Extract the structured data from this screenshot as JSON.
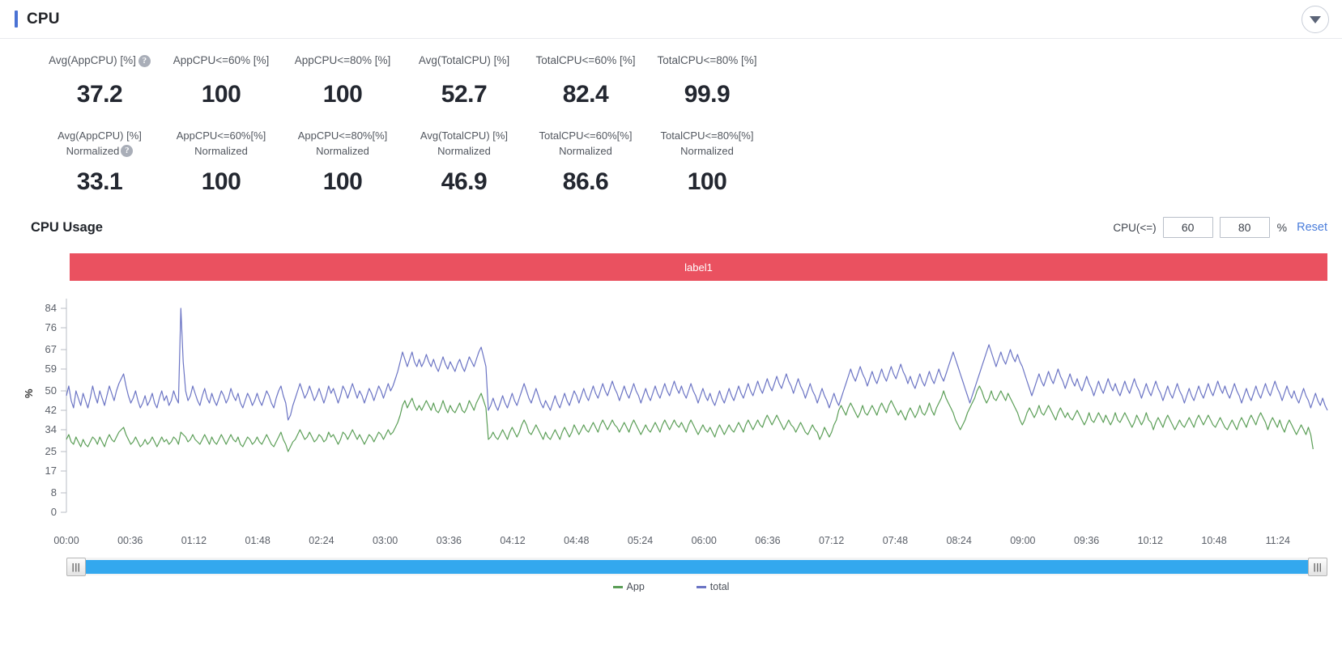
{
  "header": {
    "title": "CPU",
    "collapse_icon": "chevron-down-icon"
  },
  "kpis": {
    "row1": [
      {
        "label": "Avg(AppCPU) [%]",
        "value": "37.2",
        "help": "?"
      },
      {
        "label": "AppCPU<=60% [%]",
        "value": "100"
      },
      {
        "label": "AppCPU<=80% [%]",
        "value": "100"
      },
      {
        "label": "Avg(TotalCPU) [%]",
        "value": "52.7"
      },
      {
        "label": "TotalCPU<=60% [%]",
        "value": "82.4"
      },
      {
        "label": "TotalCPU<=80% [%]",
        "value": "99.9"
      }
    ],
    "row2": [
      {
        "label_top": "Avg(AppCPU) [%]",
        "label_bottom": "Normalized",
        "value": "33.1",
        "help": "?"
      },
      {
        "label_top": "AppCPU<=60%[%]",
        "label_bottom": "Normalized",
        "value": "100"
      },
      {
        "label_top": "AppCPU<=80%[%]",
        "label_bottom": "Normalized",
        "value": "100"
      },
      {
        "label_top": "Avg(TotalCPU) [%]",
        "label_bottom": "Normalized",
        "value": "46.9"
      },
      {
        "label_top": "TotalCPU<=60%[%]",
        "label_bottom": "Normalized",
        "value": "86.6"
      },
      {
        "label_top": "TotalCPU<=80%[%]",
        "label_bottom": "Normalized",
        "value": "100"
      }
    ]
  },
  "chart_header": {
    "title": "CPU Usage",
    "threshold_label": "CPU(<=)",
    "threshold_low": "60",
    "threshold_high": "80",
    "percent_sign": "%",
    "reset_label": "Reset"
  },
  "band": {
    "label": "label1",
    "color": "#ea5160"
  },
  "scrollbar": {
    "left_handle_glyph": "|||",
    "right_handle_glyph": "|||",
    "track_color": "#33a8ee"
  },
  "legend": [
    {
      "label": "App",
      "color": "#5b9e57"
    },
    {
      "label": "total",
      "color": "#6b74c4"
    }
  ],
  "chart_data": {
    "type": "line",
    "title": "CPU Usage",
    "xlabel": "",
    "ylabel": "%",
    "ylim": [
      0,
      88
    ],
    "grid": false,
    "y_ticks": [
      84,
      76,
      67,
      59,
      50,
      42,
      34,
      25,
      17,
      8,
      0
    ],
    "x_tick_labels": [
      "00:00",
      "00:36",
      "01:12",
      "01:48",
      "02:24",
      "03:00",
      "03:36",
      "04:12",
      "04:48",
      "05:24",
      "06:00",
      "06:36",
      "07:12",
      "07:48",
      "08:24",
      "09:00",
      "09:36",
      "10:12",
      "10:48",
      "11:24"
    ],
    "x_tick_minutes": [
      0,
      36,
      72,
      108,
      144,
      180,
      216,
      252,
      288,
      324,
      360,
      396,
      432,
      468,
      504,
      540,
      576,
      612,
      648,
      684
    ],
    "x_range_minutes": [
      0,
      712
    ],
    "series": [
      {
        "name": "total",
        "color": "#6b74c4",
        "values": [
          48,
          52,
          46,
          43,
          50,
          47,
          44,
          49,
          46,
          43,
          47,
          52,
          48,
          45,
          50,
          47,
          44,
          48,
          52,
          49,
          46,
          50,
          53,
          55,
          57,
          52,
          48,
          45,
          47,
          50,
          46,
          43,
          45,
          48,
          44,
          46,
          49,
          45,
          43,
          47,
          50,
          46,
          48,
          44,
          46,
          50,
          47,
          45,
          84,
          62,
          50,
          46,
          48,
          52,
          49,
          46,
          44,
          48,
          51,
          47,
          45,
          49,
          46,
          44,
          47,
          50,
          48,
          45,
          47,
          51,
          48,
          46,
          49,
          45,
          43,
          46,
          49,
          47,
          44,
          46,
          49,
          46,
          44,
          47,
          50,
          48,
          45,
          43,
          47,
          50,
          52,
          48,
          45,
          38,
          40,
          44,
          47,
          50,
          53,
          50,
          47,
          49,
          52,
          49,
          46,
          48,
          51,
          48,
          45,
          48,
          52,
          49,
          51,
          48,
          45,
          48,
          52,
          50,
          47,
          50,
          53,
          50,
          47,
          50,
          48,
          45,
          48,
          51,
          49,
          46,
          49,
          52,
          50,
          47,
          50,
          53,
          50,
          52,
          55,
          58,
          62,
          66,
          63,
          60,
          63,
          66,
          62,
          60,
          63,
          60,
          62,
          65,
          62,
          60,
          63,
          60,
          58,
          61,
          64,
          61,
          59,
          62,
          60,
          58,
          61,
          63,
          60,
          58,
          61,
          64,
          62,
          60,
          63,
          66,
          68,
          64,
          60,
          42,
          44,
          47,
          44,
          42,
          45,
          48,
          45,
          43,
          46,
          49,
          46,
          44,
          47,
          50,
          53,
          50,
          47,
          45,
          48,
          51,
          48,
          45,
          43,
          46,
          44,
          42,
          45,
          48,
          45,
          43,
          46,
          49,
          46,
          44,
          47,
          50,
          48,
          45,
          48,
          51,
          48,
          46,
          49,
          52,
          49,
          47,
          50,
          53,
          50,
          48,
          51,
          54,
          51,
          49,
          46,
          49,
          52,
          49,
          47,
          50,
          53,
          50,
          48,
          45,
          48,
          51,
          48,
          46,
          49,
          52,
          49,
          47,
          50,
          53,
          50,
          48,
          51,
          54,
          51,
          49,
          52,
          49,
          47,
          50,
          53,
          50,
          48,
          45,
          48,
          51,
          48,
          46,
          49,
          46,
          44,
          47,
          50,
          47,
          45,
          48,
          51,
          48,
          46,
          49,
          52,
          49,
          47,
          50,
          53,
          50,
          48,
          51,
          54,
          51,
          49,
          52,
          55,
          52,
          50,
          53,
          56,
          53,
          51,
          54,
          57,
          54,
          52,
          49,
          52,
          55,
          52,
          50,
          47,
          50,
          53,
          50,
          48,
          45,
          48,
          51,
          48,
          46,
          43,
          46,
          49,
          46,
          44,
          47,
          50,
          53,
          56,
          59,
          56,
          54,
          57,
          60,
          57,
          55,
          52,
          55,
          58,
          55,
          53,
          56,
          59,
          56,
          54,
          57,
          60,
          57,
          55,
          58,
          61,
          58,
          56,
          53,
          56,
          53,
          51,
          54,
          57,
          54,
          52,
          55,
          58,
          55,
          53,
          56,
          59,
          56,
          54,
          57,
          60,
          63,
          66,
          63,
          60,
          57,
          54,
          51,
          48,
          45,
          48,
          51,
          54,
          57,
          60,
          63,
          66,
          69,
          66,
          63,
          60,
          63,
          66,
          63,
          61,
          64,
          67,
          64,
          62,
          65,
          62,
          60,
          57,
          54,
          51,
          48,
          51,
          54,
          57,
          54,
          52,
          55,
          58,
          55,
          53,
          56,
          59,
          56,
          54,
          51,
          54,
          57,
          54,
          52,
          55,
          52,
          50,
          53,
          56,
          53,
          51,
          48,
          51,
          54,
          51,
          49,
          52,
          55,
          52,
          50,
          53,
          50,
          48,
          51,
          54,
          51,
          49,
          52,
          55,
          52,
          50,
          47,
          50,
          53,
          50,
          48,
          51,
          54,
          51,
          49,
          46,
          49,
          52,
          49,
          47,
          50,
          53,
          50,
          48,
          45,
          48,
          51,
          48,
          46,
          49,
          52,
          49,
          47,
          50,
          53,
          50,
          48,
          51,
          54,
          51,
          49,
          52,
          49,
          47,
          50,
          53,
          50,
          48,
          45,
          48,
          51,
          48,
          46,
          49,
          52,
          49,
          47,
          50,
          53,
          50,
          48,
          51,
          54,
          51,
          49,
          46,
          49,
          52,
          49,
          47,
          50,
          47,
          45,
          48,
          51,
          48,
          46,
          43,
          46,
          49,
          46,
          44,
          47,
          44,
          42
        ]
      },
      {
        "name": "App",
        "color": "#5b9e57",
        "values": [
          30,
          32,
          29,
          28,
          31,
          29,
          27,
          30,
          28,
          27,
          29,
          31,
          30,
          28,
          31,
          29,
          27,
          30,
          32,
          30,
          29,
          31,
          33,
          34,
          35,
          32,
          30,
          28,
          29,
          31,
          29,
          27,
          28,
          30,
          28,
          29,
          31,
          29,
          27,
          29,
          31,
          29,
          30,
          28,
          29,
          31,
          30,
          28,
          33,
          32,
          31,
          29,
          30,
          32,
          30,
          29,
          28,
          30,
          32,
          30,
          28,
          31,
          29,
          28,
          30,
          32,
          30,
          28,
          30,
          32,
          30,
          29,
          31,
          28,
          27,
          29,
          31,
          30,
          28,
          29,
          31,
          29,
          28,
          30,
          32,
          30,
          28,
          27,
          29,
          31,
          33,
          30,
          28,
          25,
          27,
          29,
          30,
          32,
          34,
          32,
          30,
          31,
          33,
          31,
          29,
          30,
          32,
          31,
          29,
          30,
          33,
          31,
          32,
          30,
          28,
          30,
          33,
          32,
          30,
          32,
          34,
          32,
          30,
          32,
          30,
          28,
          30,
          32,
          31,
          29,
          31,
          33,
          32,
          30,
          32,
          34,
          32,
          33,
          35,
          37,
          40,
          44,
          46,
          43,
          45,
          47,
          44,
          42,
          44,
          42,
          44,
          46,
          44,
          42,
          45,
          42,
          41,
          43,
          46,
          43,
          41,
          44,
          42,
          41,
          43,
          45,
          42,
          41,
          43,
          46,
          44,
          42,
          45,
          47,
          49,
          46,
          43,
          30,
          31,
          33,
          31,
          30,
          32,
          34,
          32,
          30,
          33,
          35,
          33,
          31,
          33,
          36,
          38,
          36,
          33,
          32,
          34,
          36,
          34,
          32,
          30,
          33,
          31,
          30,
          32,
          34,
          32,
          30,
          33,
          35,
          33,
          31,
          33,
          36,
          34,
          32,
          34,
          36,
          34,
          33,
          35,
          37,
          35,
          33,
          36,
          38,
          36,
          34,
          36,
          38,
          36,
          35,
          33,
          35,
          37,
          35,
          33,
          36,
          38,
          36,
          34,
          32,
          34,
          36,
          34,
          33,
          35,
          37,
          35,
          33,
          36,
          38,
          36,
          34,
          36,
          38,
          36,
          35,
          37,
          35,
          33,
          36,
          38,
          36,
          34,
          32,
          34,
          36,
          34,
          33,
          35,
          33,
          31,
          34,
          36,
          34,
          32,
          34,
          36,
          34,
          33,
          35,
          37,
          35,
          33,
          36,
          38,
          36,
          34,
          36,
          38,
          36,
          35,
          38,
          40,
          38,
          36,
          38,
          40,
          38,
          36,
          34,
          36,
          38,
          36,
          35,
          33,
          35,
          37,
          35,
          33,
          32,
          34,
          36,
          34,
          33,
          30,
          32,
          35,
          33,
          31,
          33,
          36,
          38,
          42,
          44,
          42,
          40,
          43,
          45,
          43,
          41,
          39,
          41,
          44,
          41,
          40,
          42,
          44,
          42,
          40,
          43,
          45,
          43,
          41,
          44,
          46,
          44,
          42,
          40,
          42,
          40,
          38,
          41,
          43,
          41,
          39,
          41,
          44,
          41,
          40,
          42,
          45,
          42,
          40,
          43,
          45,
          47,
          50,
          47,
          45,
          43,
          41,
          38,
          36,
          34,
          36,
          38,
          41,
          43,
          45,
          47,
          50,
          52,
          50,
          47,
          45,
          47,
          50,
          47,
          46,
          48,
          50,
          48,
          46,
          49,
          47,
          45,
          43,
          41,
          38,
          36,
          38,
          41,
          43,
          41,
          39,
          41,
          44,
          41,
          40,
          42,
          44,
          42,
          40,
          38,
          41,
          43,
          41,
          39,
          41,
          39,
          38,
          40,
          42,
          40,
          38,
          36,
          38,
          41,
          38,
          37,
          39,
          41,
          39,
          37,
          40,
          38,
          36,
          38,
          41,
          38,
          37,
          39,
          41,
          39,
          37,
          35,
          37,
          40,
          38,
          36,
          38,
          41,
          38,
          37,
          34,
          37,
          39,
          37,
          35,
          38,
          40,
          38,
          36,
          34,
          36,
          38,
          36,
          35,
          37,
          39,
          37,
          35,
          38,
          40,
          38,
          36,
          38,
          40,
          38,
          36,
          35,
          37,
          39,
          37,
          35,
          34,
          36,
          38,
          36,
          34,
          37,
          39,
          37,
          35,
          38,
          40,
          38,
          36,
          39,
          41,
          39,
          37,
          34,
          37,
          39,
          37,
          35,
          38,
          35,
          33,
          36,
          38,
          36,
          34,
          32,
          34,
          36,
          34,
          32,
          35,
          32,
          26
        ]
      }
    ]
  }
}
